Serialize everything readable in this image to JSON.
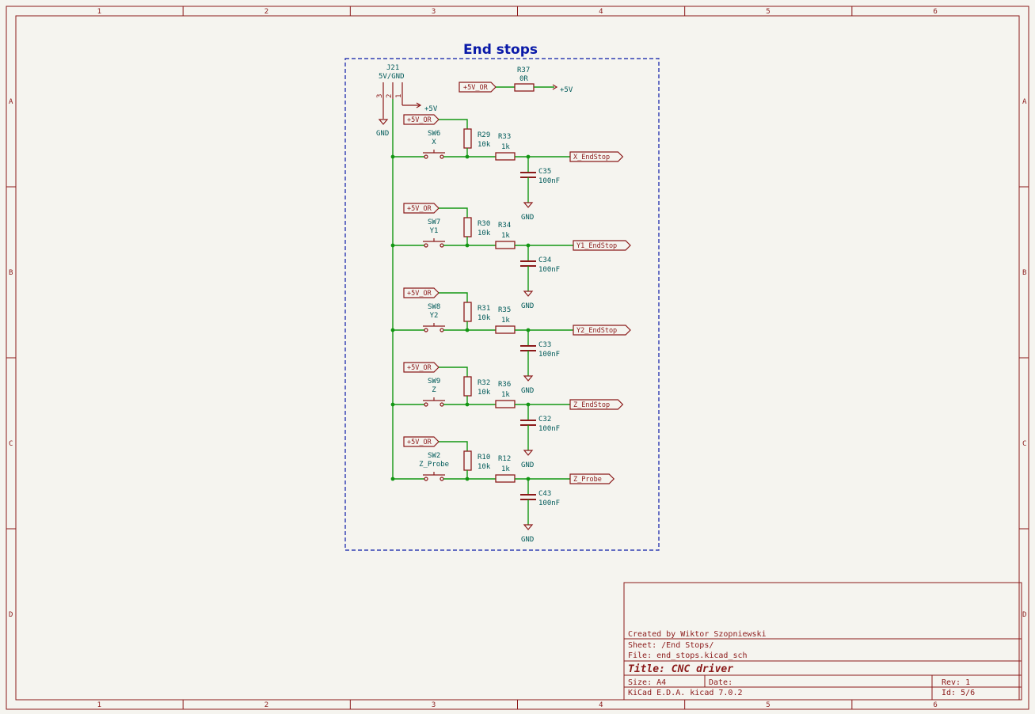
{
  "sheet_title": "End stops",
  "border": {
    "columns": [
      "1",
      "2",
      "3",
      "4",
      "5",
      "6"
    ],
    "rows": [
      "A",
      "B",
      "C",
      "D"
    ]
  },
  "connector": {
    "ref": "J21",
    "value": "5V/GND",
    "pins": [
      "3",
      "2",
      "1"
    ]
  },
  "power": {
    "plus5": "+5V",
    "gnd": "GND",
    "plus5_or": "+5V_OR"
  },
  "top_resistor": {
    "ref": "R37",
    "value": "0R"
  },
  "channels": [
    {
      "sw": "SW6",
      "sw_val": "X",
      "r_pull": "R29",
      "r_pull_val": "10k",
      "r_ser": "R33",
      "r_ser_val": "1k",
      "cap": "C35",
      "cap_val": "100nF",
      "net": "X_EndStop"
    },
    {
      "sw": "SW7",
      "sw_val": "Y1",
      "r_pull": "R30",
      "r_pull_val": "10k",
      "r_ser": "R34",
      "r_ser_val": "1k",
      "cap": "C34",
      "cap_val": "100nF",
      "net": "Y1_EndStop"
    },
    {
      "sw": "SW8",
      "sw_val": "Y2",
      "r_pull": "R31",
      "r_pull_val": "10k",
      "r_ser": "R35",
      "r_ser_val": "1k",
      "cap": "C33",
      "cap_val": "100nF",
      "net": "Y2_EndStop"
    },
    {
      "sw": "SW9",
      "sw_val": "Z",
      "r_pull": "R32",
      "r_pull_val": "10k",
      "r_ser": "R36",
      "r_ser_val": "1k",
      "cap": "C32",
      "cap_val": "100nF",
      "net": "Z_EndStop"
    },
    {
      "sw": "SW2",
      "sw_val": "Z_Probe",
      "r_pull": "R10",
      "r_pull_val": "10k",
      "r_ser": "R12",
      "r_ser_val": "1k",
      "cap": "C43",
      "cap_val": "100nF",
      "net": "Z_Probe"
    }
  ],
  "title_block": {
    "created_by": "Created by Wiktor Szopniewski",
    "sheet": "Sheet: /End Stops/",
    "file": "File: end_stops.kicad_sch",
    "title": "Title: CNC driver",
    "size": "Size: A4",
    "date": "Date:",
    "rev": "Rev: 1",
    "tool": "KiCad E.D.A.  kicad 7.0.2",
    "id": "Id: 5/6"
  },
  "colors": {
    "frame": "#8b1a1a",
    "wire": "#139613",
    "label": "#005a5a",
    "title": "#0a1aa8",
    "sheet_border": "#0a1aa8",
    "background": "#f5f4ef"
  }
}
